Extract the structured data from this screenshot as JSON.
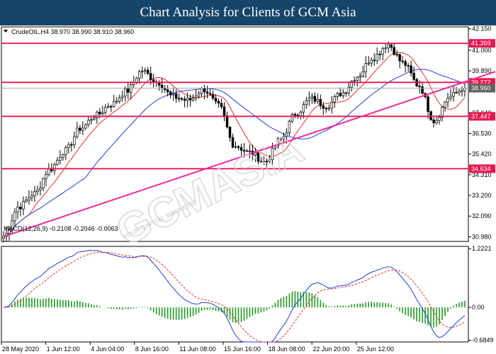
{
  "banner_title": "Chart Analysis for Clients of GCM Asia",
  "watermark": "GCMASIA",
  "watermark_sub": "YOUR CAPITAL MARKETS",
  "chart_data": [
    {
      "type": "candlestick",
      "symbol_line": "CrudeOIL,H4  38.970 38.990 38.910 38.960",
      "ylim": [
        30.73,
        42.25
      ],
      "y_ticks": [
        "42.150",
        "41.000",
        "39.890",
        "37.640",
        "36.530",
        "35.420",
        "34.310",
        "33.200",
        "32.090",
        "30.980"
      ],
      "x_labels": [
        "28 May 2020",
        "1 Jun 12:00",
        "4 Jun 04:00",
        "8 Jun 16:00",
        "11 Jun 08:00",
        "15 Jun 16:00",
        "18 Jun 08:00",
        "22 Jun 20:00",
        "25 Jun 12:00"
      ],
      "close_anchors": [
        31.0,
        32.6,
        33.3,
        34.6,
        35.6,
        36.8,
        37.5,
        38.1,
        38.8,
        39.9,
        39.3,
        38.5,
        38.3,
        38.9,
        38.0,
        35.9,
        35.5,
        35.0,
        36.2,
        37.6,
        38.4,
        38.0,
        38.7,
        39.6,
        40.6,
        41.3,
        40.3,
        39.1,
        37.2,
        38.5,
        39.0
      ],
      "horizontal_levels": [
        {
          "value": 41.369,
          "label": "41.369",
          "color": "#e8174f"
        },
        {
          "value": 39.272,
          "label": "39.272",
          "color": "#e8174f"
        },
        {
          "value": 37.447,
          "label": "37.447",
          "color": "#e8174f"
        },
        {
          "value": 34.634,
          "label": "34.634",
          "color": "#e8174f"
        }
      ],
      "current_price": {
        "value": 38.96,
        "label": "38.960",
        "color": "#606060"
      },
      "trendline": {
        "color": "#ee2a9c",
        "from": {
          "bar": 0,
          "price": 30.99
        },
        "to": {
          "bar": 163,
          "price": 39.3
        }
      },
      "moving_averages": [
        {
          "period": 10,
          "color": "#e52d2d"
        },
        {
          "period": 30,
          "color": "#1f3fd6"
        }
      ]
    },
    {
      "type": "macd",
      "header": "MACD(12,26,9) -0.2108 -0.2046 -0.0063",
      "ylim": [
        -0.72,
        1.27
      ],
      "y_ticks": [
        "1.2221",
        "0.00",
        "-0.6849"
      ],
      "colors": {
        "histogram": "#1f9a1f",
        "macd": "#1f3fd6",
        "signal": "#e52d2d"
      }
    }
  ]
}
